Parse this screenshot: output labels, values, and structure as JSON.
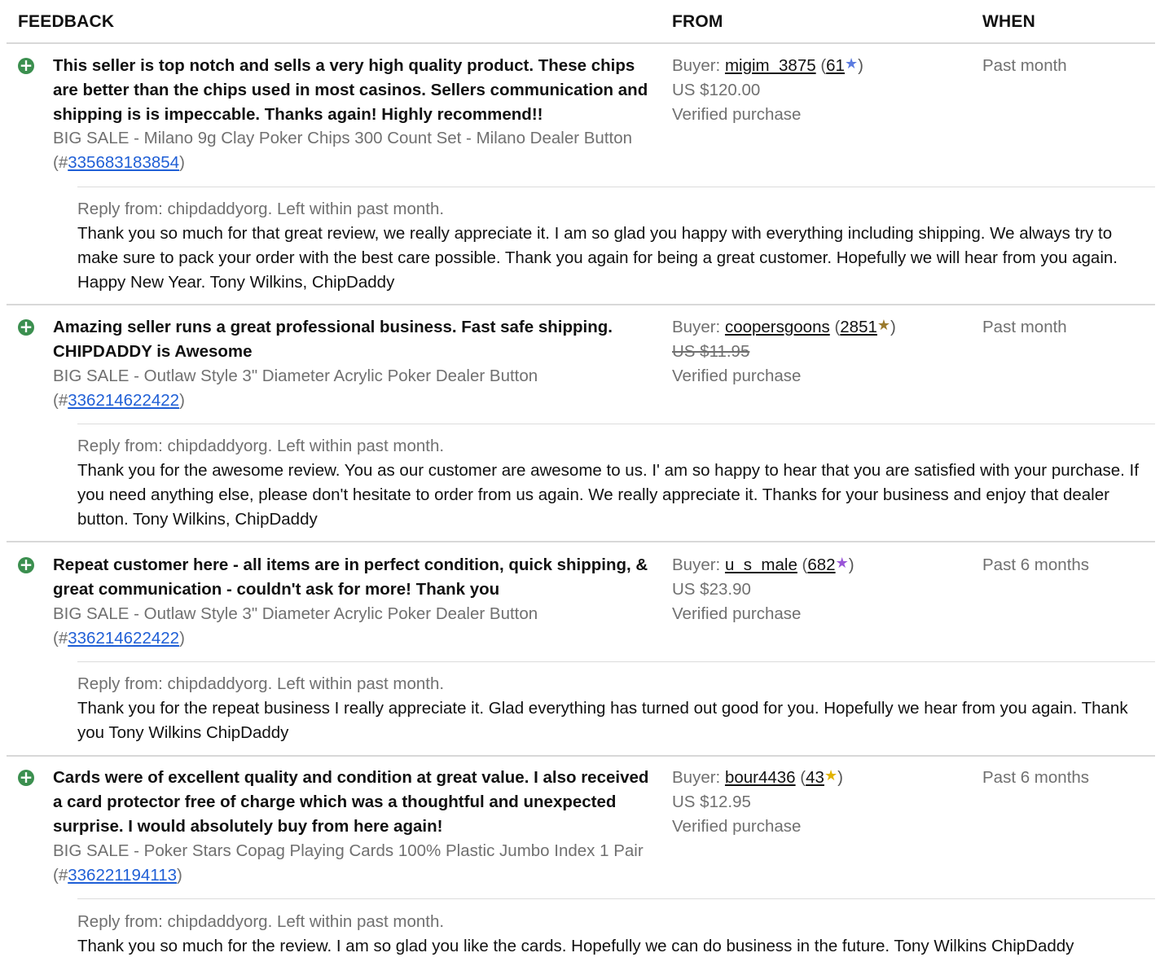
{
  "header": {
    "feedback": "FEEDBACK",
    "from": "FROM",
    "when": "WHEN"
  },
  "star_colors": {
    "purple_blue": "#5b7be0",
    "gold_brown": "#9b7a2c",
    "purple": "#9a55d8",
    "yellow": "#e2b400"
  },
  "entries": [
    {
      "comment": "This seller is top notch and sells a very high quality product. These chips are better than the chips used in most casinos. Sellers communication and shipping is is impeccable. Thanks again! Highly recommend!!",
      "item_title": "BIG SALE - Milano 9g Clay Poker Chips 300 Count Set - Milano Dealer Button",
      "item_prefix": "(#",
      "item_number": "335683183854",
      "item_suffix": ")",
      "buyer_label": "Buyer: ",
      "buyer": "migim_3875",
      "score": "61",
      "star": "★",
      "star_color": "#5b7be0",
      "price": "US $120.00",
      "verified": "Verified purchase",
      "when": "Past month",
      "reply_meta": "Reply from: chipdaddyorg. Left within past month.",
      "reply_text": "Thank you so much for that great review, we really appreciate it. I am so glad you happy with everything including shipping. We always try to make sure to pack your order with the best care possible. Thank you again for being a great customer. Hopefully we will hear from you again. Happy New Year. Tony Wilkins, ChipDaddy"
    },
    {
      "comment": "Amazing seller runs a great professional business. Fast safe shipping. CHIPDADDY is Awesome",
      "item_title": "BIG SALE - Outlaw Style 3\" Diameter Acrylic Poker Dealer Button",
      "item_prefix": "(#",
      "item_number": "336214622422",
      "item_suffix": ")",
      "buyer_label": "Buyer: ",
      "buyer": "coopersgoons",
      "score": "2851",
      "star": "★",
      "star_color": "#9b7a2c",
      "price": "US $11.95",
      "verified": "Verified purchase",
      "when": "Past month",
      "reply_meta": "Reply from: chipdaddyorg. Left within past month.",
      "reply_text": "Thank you for the awesome review. You as our customer are awesome to us. I' am so happy to hear that you are satisfied with your purchase. If you need anything else, please don't hesitate to order from us again. We really appreciate it. Thanks for your business and enjoy that dealer button. Tony Wilkins, ChipDaddy"
    },
    {
      "comment": "Repeat customer here - all items are in perfect condition, quick shipping, & great communication - couldn't ask for more! Thank you",
      "item_title": "BIG SALE - Outlaw Style 3\" Diameter Acrylic Poker Dealer Button",
      "item_prefix": "(#",
      "item_number": "336214622422",
      "item_suffix": ")",
      "buyer_label": "Buyer: ",
      "buyer": "u_s_male",
      "score": "682",
      "star": "★",
      "star_color": "#9a55d8",
      "price": "US $23.90",
      "verified": "Verified purchase",
      "when": "Past 6 months",
      "reply_meta": "Reply from: chipdaddyorg. Left within past month.",
      "reply_text": "Thank you for the repeat business I really appreciate it. Glad everything has turned out good for you. Hopefully we hear from you again. Thank you Tony Wilkins ChipDaddy"
    },
    {
      "comment": "Cards were of excellent quality and condition at great value. I also received a card protector free of charge which was a thoughtful and unexpected surprise. I would absolutely buy from here again!",
      "item_title": "BIG SALE - Poker Stars Copag Playing Cards 100% Plastic Jumbo Index 1 Pair",
      "item_prefix": "(#",
      "item_number": "336221194113",
      "item_suffix": ")",
      "buyer_label": "Buyer: ",
      "buyer": "bour4436",
      "score": "43",
      "star": "★",
      "star_color": "#e2b400",
      "price": "US $12.95",
      "verified": "Verified purchase",
      "when": "Past 6 months",
      "reply_meta": "Reply from: chipdaddyorg. Left within past month.",
      "reply_text": "Thank you so much for the review. I am so glad you like the cards. Hopefully we can do business in the future. Tony Wilkins ChipDaddy"
    }
  ]
}
